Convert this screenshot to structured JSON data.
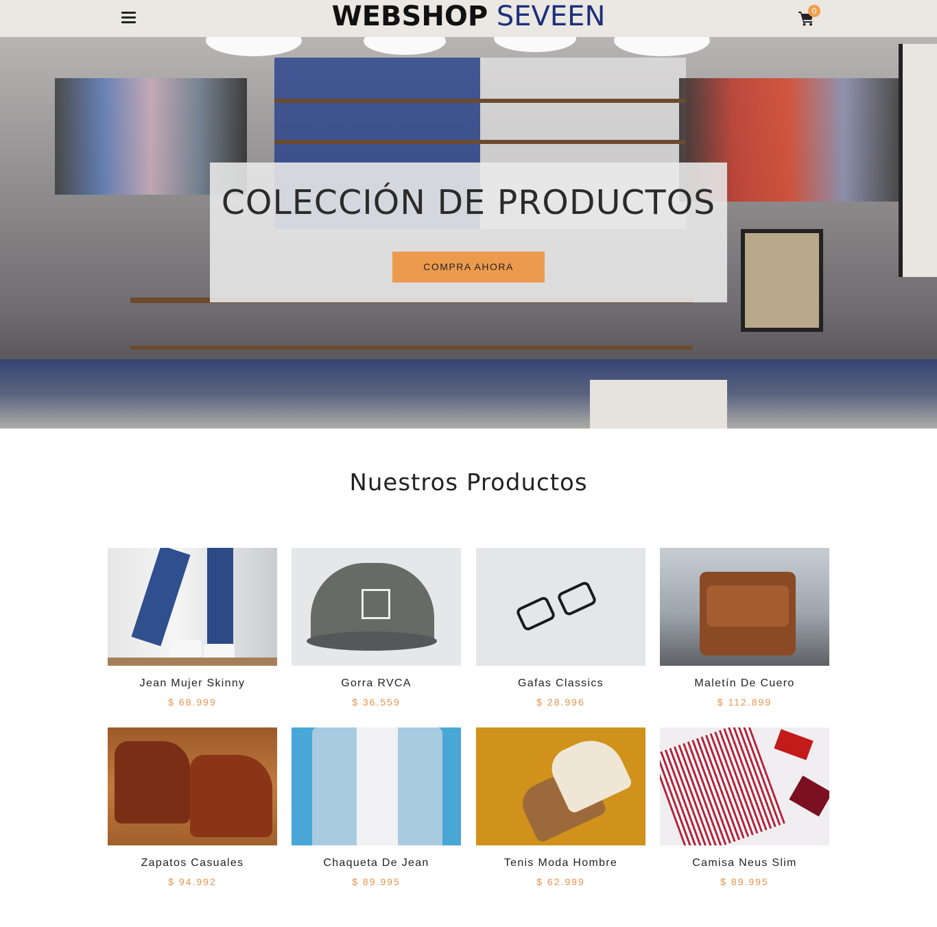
{
  "header": {
    "brand_part1": "WEBSHOP",
    "brand_part2": "SEVEEN",
    "cart_count": "0",
    "menu_icon": "hamburger-icon",
    "cart_icon": "shopping-cart-icon"
  },
  "hero": {
    "title": "COLECCIÓN DE PRODUCTOS",
    "cta_label": "COMPRA AHORA"
  },
  "products_section": {
    "title": "Nuestros Productos"
  },
  "products": [
    {
      "name": "Jean Mujer Skinny",
      "price": "$ 68.999"
    },
    {
      "name": "Gorra RVCA",
      "price": "$ 36.559"
    },
    {
      "name": "Gafas Classics",
      "price": "$ 28.996"
    },
    {
      "name": "Maletín De Cuero",
      "price": "$ 112.899"
    },
    {
      "name": "Zapatos Casuales",
      "price": "$ 94.992"
    },
    {
      "name": "Chaqueta De Jean",
      "price": "$ 89.995"
    },
    {
      "name": "Tenis Moda Hombre",
      "price": "$ 62.999"
    },
    {
      "name": "Camisa Neus Slim",
      "price": "$ 89.995"
    }
  ],
  "colors": {
    "header_bg": "#ebe7e3",
    "brand_blue": "#1c2f7a",
    "accent_orange": "#ec9a4d",
    "price_orange": "#e8914a"
  }
}
